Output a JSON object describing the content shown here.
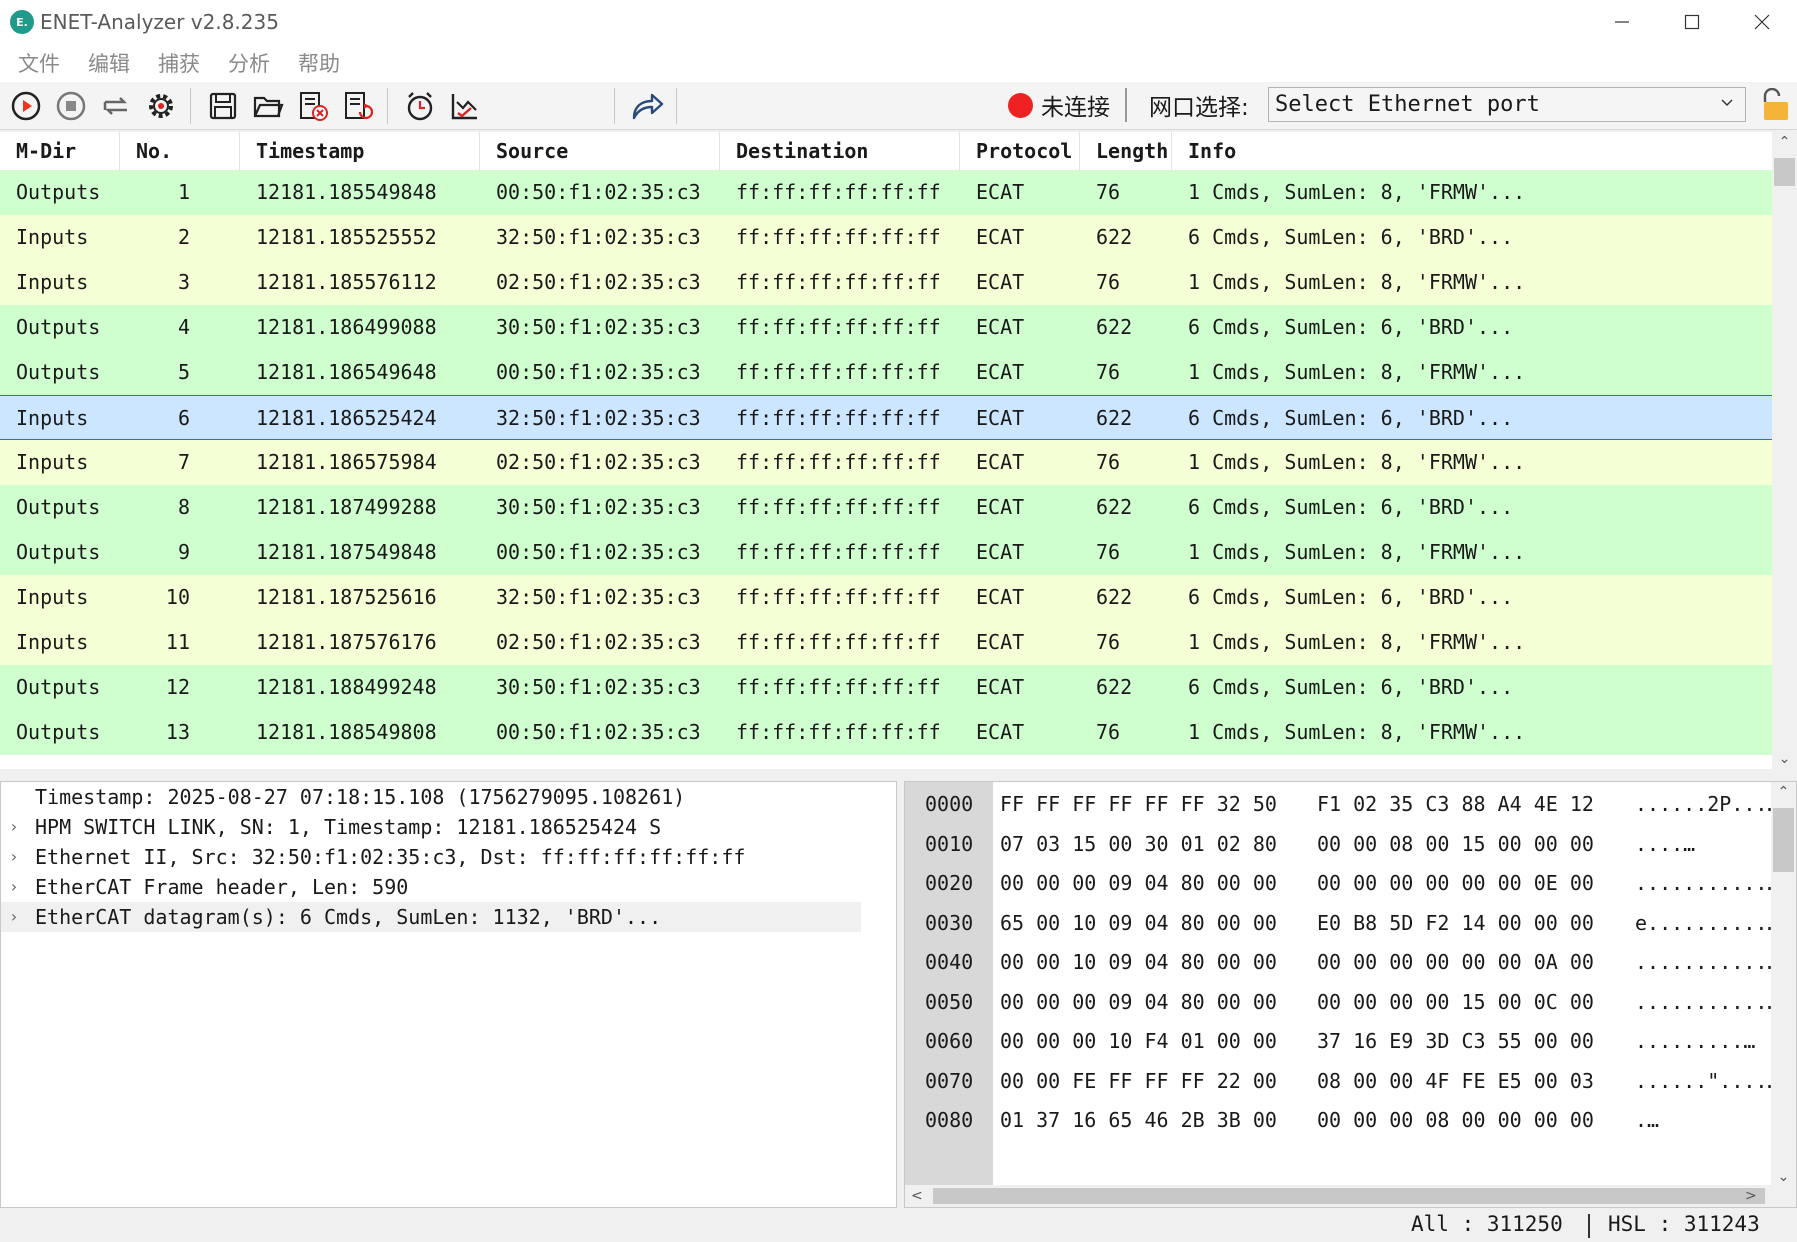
{
  "window": {
    "title": "ENET-Analyzer v2.8.235",
    "app_icon_text": "E."
  },
  "menu": [
    "文件",
    "编辑",
    "捕获",
    "分析",
    "帮助"
  ],
  "toolbar": {
    "icons": [
      "play-circle-icon",
      "stop-circle-icon",
      "restart-icon",
      "gear-icon",
      "save-icon",
      "open-folder-icon",
      "clear-file-icon",
      "reload-file-icon",
      "alarm-clock-icon",
      "chart-check-icon",
      "share-arrow-icon"
    ],
    "connection_status": "未连接",
    "port_label": "网口选择:",
    "port_select_value": "Select Ethernet port"
  },
  "table": {
    "columns": [
      "M-Dir",
      "No.",
      "Timestamp",
      "Source",
      "Destination",
      "Protocol",
      "Length",
      "Info"
    ],
    "rows": [
      {
        "dir": "Outputs",
        "no": "1",
        "ts": "12181.185549848",
        "src": "00:50:f1:02:35:c3",
        "dst": "ff:ff:ff:ff:ff:ff",
        "proto": "ECAT",
        "len": "76",
        "info": "1 Cmds, SumLen: 8, 'FRMW'..."
      },
      {
        "dir": "Inputs",
        "no": "2",
        "ts": "12181.185525552",
        "src": "32:50:f1:02:35:c3",
        "dst": "ff:ff:ff:ff:ff:ff",
        "proto": "ECAT",
        "len": "622",
        "info": "6 Cmds, SumLen: 6, 'BRD'..."
      },
      {
        "dir": "Inputs",
        "no": "3",
        "ts": "12181.185576112",
        "src": "02:50:f1:02:35:c3",
        "dst": "ff:ff:ff:ff:ff:ff",
        "proto": "ECAT",
        "len": "76",
        "info": "1 Cmds, SumLen: 8, 'FRMW'..."
      },
      {
        "dir": "Outputs",
        "no": "4",
        "ts": "12181.186499088",
        "src": "30:50:f1:02:35:c3",
        "dst": "ff:ff:ff:ff:ff:ff",
        "proto": "ECAT",
        "len": "622",
        "info": "6 Cmds, SumLen: 6, 'BRD'..."
      },
      {
        "dir": "Outputs",
        "no": "5",
        "ts": "12181.186549648",
        "src": "00:50:f1:02:35:c3",
        "dst": "ff:ff:ff:ff:ff:ff",
        "proto": "ECAT",
        "len": "76",
        "info": "1 Cmds, SumLen: 8, 'FRMW'..."
      },
      {
        "dir": "Inputs",
        "no": "6",
        "ts": "12181.186525424",
        "src": "32:50:f1:02:35:c3",
        "dst": "ff:ff:ff:ff:ff:ff",
        "proto": "ECAT",
        "len": "622",
        "info": "6 Cmds, SumLen: 6, 'BRD'..."
      },
      {
        "dir": "Inputs",
        "no": "7",
        "ts": "12181.186575984",
        "src": "02:50:f1:02:35:c3",
        "dst": "ff:ff:ff:ff:ff:ff",
        "proto": "ECAT",
        "len": "76",
        "info": "1 Cmds, SumLen: 8, 'FRMW'..."
      },
      {
        "dir": "Outputs",
        "no": "8",
        "ts": "12181.187499288",
        "src": "30:50:f1:02:35:c3",
        "dst": "ff:ff:ff:ff:ff:ff",
        "proto": "ECAT",
        "len": "622",
        "info": "6 Cmds, SumLen: 6, 'BRD'..."
      },
      {
        "dir": "Outputs",
        "no": "9",
        "ts": "12181.187549848",
        "src": "00:50:f1:02:35:c3",
        "dst": "ff:ff:ff:ff:ff:ff",
        "proto": "ECAT",
        "len": "76",
        "info": "1 Cmds, SumLen: 8, 'FRMW'..."
      },
      {
        "dir": "Inputs",
        "no": "10",
        "ts": "12181.187525616",
        "src": "32:50:f1:02:35:c3",
        "dst": "ff:ff:ff:ff:ff:ff",
        "proto": "ECAT",
        "len": "622",
        "info": "6 Cmds, SumLen: 6, 'BRD'..."
      },
      {
        "dir": "Inputs",
        "no": "11",
        "ts": "12181.187576176",
        "src": "02:50:f1:02:35:c3",
        "dst": "ff:ff:ff:ff:ff:ff",
        "proto": "ECAT",
        "len": "76",
        "info": "1 Cmds, SumLen: 8, 'FRMW'..."
      },
      {
        "dir": "Outputs",
        "no": "12",
        "ts": "12181.188499248",
        "src": "30:50:f1:02:35:c3",
        "dst": "ff:ff:ff:ff:ff:ff",
        "proto": "ECAT",
        "len": "622",
        "info": "6 Cmds, SumLen: 6, 'BRD'..."
      },
      {
        "dir": "Outputs",
        "no": "13",
        "ts": "12181.188549808",
        "src": "00:50:f1:02:35:c3",
        "dst": "ff:ff:ff:ff:ff:ff",
        "proto": "ECAT",
        "len": "76",
        "info": "1 Cmds, SumLen: 8, 'FRMW'..."
      }
    ],
    "selected_row_no": "6"
  },
  "details": [
    {
      "text": "Timestamp: 2025-08-27 07:18:15.108 (1756279095.108261)",
      "expandable": false
    },
    {
      "text": "HPM SWITCH LINK, SN: 1, Timestamp: 12181.186525424 S",
      "expandable": true
    },
    {
      "text": "Ethernet II, Src: 32:50:f1:02:35:c3, Dst: ff:ff:ff:ff:ff:ff",
      "expandable": true
    },
    {
      "text": "EtherCAT Frame header, Len: 590",
      "expandable": true
    },
    {
      "text": "EtherCAT datagram(s): 6 Cmds, SumLen: 1132, 'BRD'...",
      "expandable": true
    }
  ],
  "hex": [
    {
      "off": "0000",
      "b1": "FF FF FF FF FF FF 32 50",
      "b2": "F1 02 35 C3 88 A4 4E 12",
      "asc": "......2P...…"
    },
    {
      "off": "0010",
      "b1": "07 03 15 00 30 01 02 80",
      "b2": "00 00 08 00 15 00 00 00",
      "asc": "....…"
    },
    {
      "off": "0020",
      "b1": "00 00 00 09 04 80 00 00",
      "b2": "00 00 00 00 00 00 0E 00",
      "asc": "...........…"
    },
    {
      "off": "0030",
      "b1": "65 00 10 09 04 80 00 00",
      "b2": "E0 B8 5D F2 14 00 00 00",
      "asc": "e..........…"
    },
    {
      "off": "0040",
      "b1": "00 00 10 09 04 80 00 00",
      "b2": "00 00 00 00 00 00 0A 00",
      "asc": "...........…"
    },
    {
      "off": "0050",
      "b1": "00 00 00 09 04 80 00 00",
      "b2": "00 00 00 00 15 00 0C 00",
      "asc": "...........…"
    },
    {
      "off": "0060",
      "b1": "00 00 00 10 F4 01 00 00",
      "b2": "37 16 E9 3D C3 55 00 00",
      "asc": ".........…"
    },
    {
      "off": "0070",
      "b1": "00 00 FE FF FF FF 22 00",
      "b2": "08 00 00 4F FE E5 00 03",
      "asc": "......\"....…"
    },
    {
      "off": "0080",
      "b1": "01 37 16 65 46 2B 3B 00",
      "b2": "00 00 00 08 00 00 00 00",
      "asc": ".…"
    }
  ],
  "statusbar": {
    "all": "All : 311250",
    "hsl": "HSL : 311243"
  },
  "colors": {
    "outputs_row": "#cfffcf",
    "inputs_row": "#f4ffd6",
    "selected_row": "#cce6ff",
    "disconnected": "#ee2222"
  }
}
